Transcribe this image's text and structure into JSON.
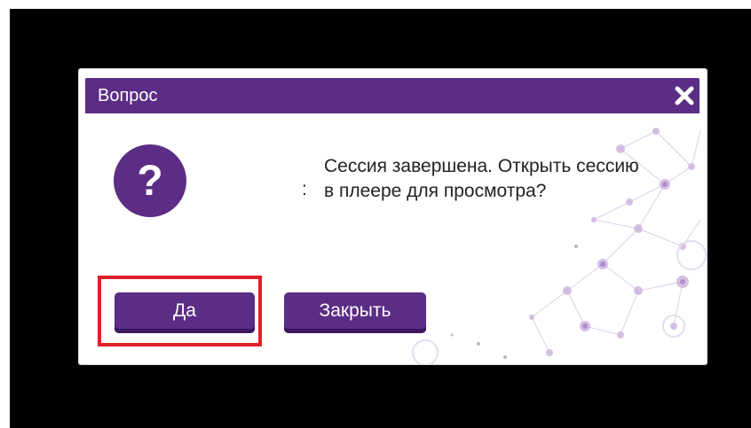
{
  "dialog": {
    "title": "Вопрос",
    "message_separator": ":",
    "message": "Сессия завершена. Открыть сессию в плеере для просмотра?",
    "buttons": {
      "yes_label": "Да",
      "close_label": "Закрыть"
    },
    "icons": {
      "close": "close-icon",
      "question": "question-icon"
    }
  },
  "colors": {
    "accent": "#5b2d84",
    "highlight": "#e0202a",
    "background": "#000000"
  }
}
